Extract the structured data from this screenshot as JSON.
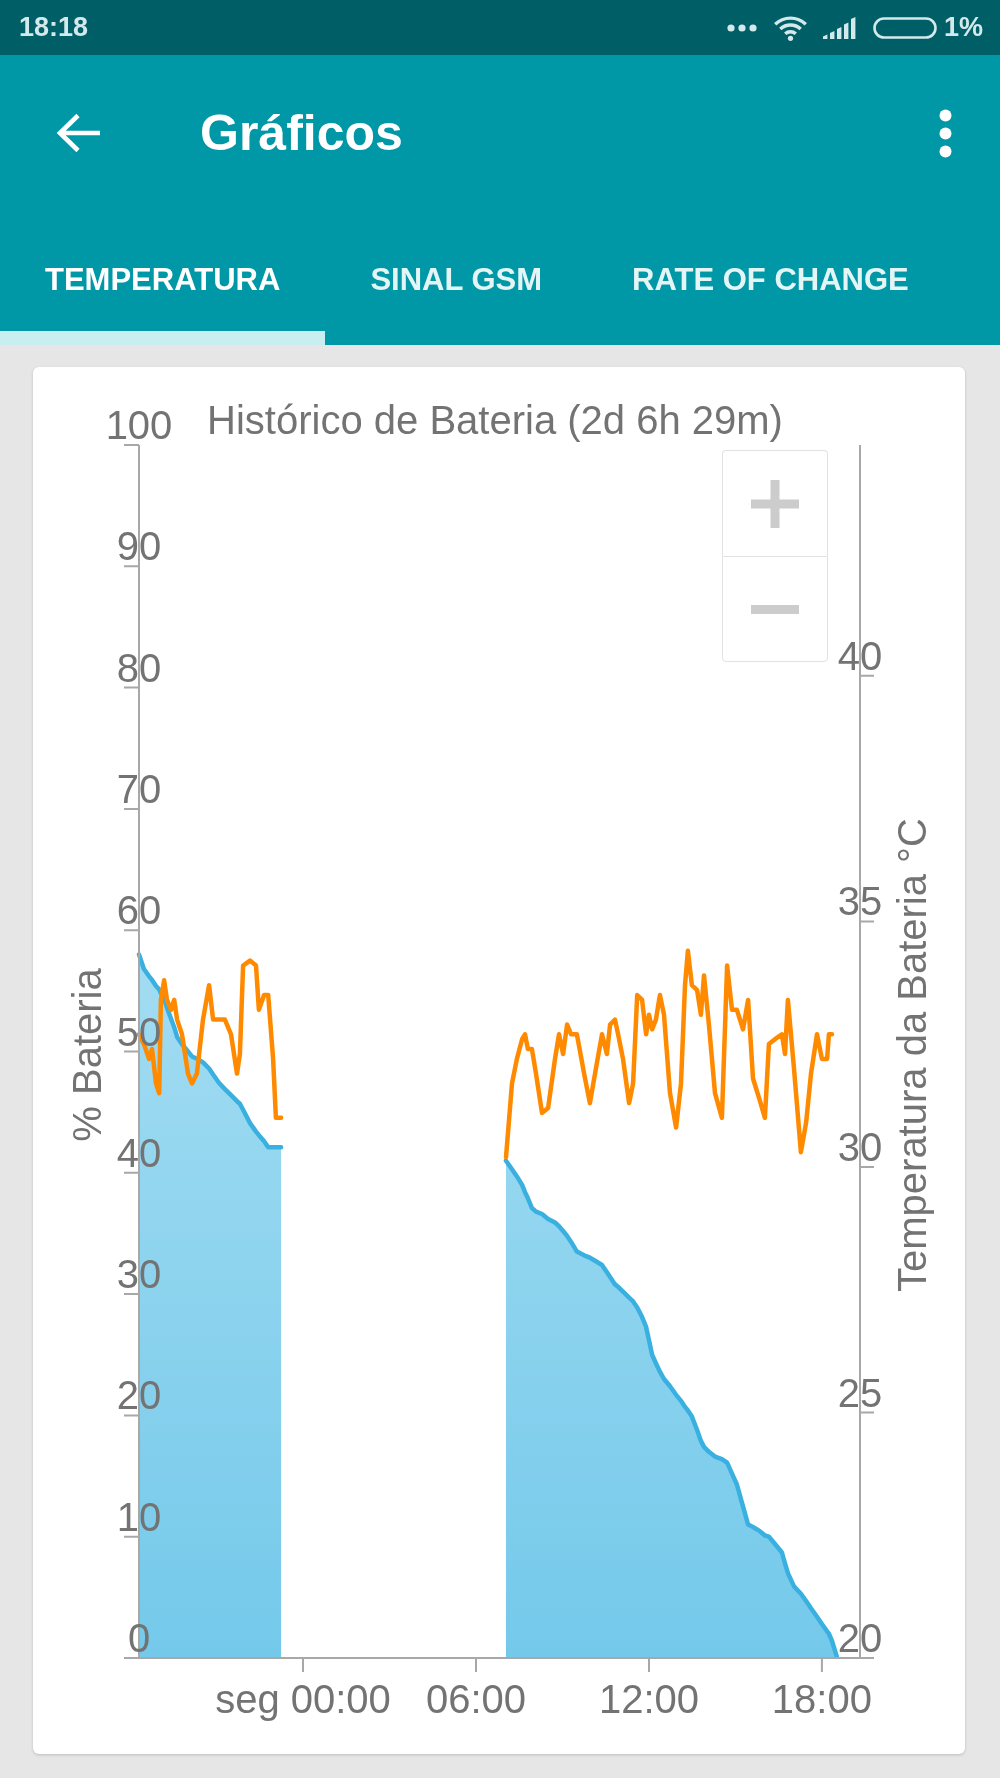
{
  "status_bar": {
    "time": "18:18",
    "battery": "1%"
  },
  "app_bar": {
    "title": "Gráficos"
  },
  "tabs": [
    {
      "label": "TEMPERATURA",
      "selected": true
    },
    {
      "label": "SINAL GSM",
      "selected": false
    },
    {
      "label": "RATE OF CHANGE",
      "selected": false
    }
  ],
  "chart": {
    "chart_data": {
      "type": "area",
      "title": "Histórico de Bateria (2d 6h 29m)",
      "ylabel": "% Bateria",
      "y2label": "Temperatura da Bateria °C",
      "xlim": [
        -5.69,
        19.32
      ],
      "ylim": [
        0,
        100
      ],
      "y2lim": [
        20,
        44.7
      ],
      "xticks": [
        {
          "value": 0,
          "label": "seg 00:00"
        },
        {
          "value": 6,
          "label": "06:00"
        },
        {
          "value": 12,
          "label": "12:00"
        },
        {
          "value": 18,
          "label": "18:00"
        }
      ],
      "yticks": [
        0,
        10,
        20,
        30,
        40,
        50,
        60,
        70,
        80,
        90,
        100
      ],
      "y2ticks": [
        20,
        25,
        30,
        35,
        40
      ],
      "x": [
        -5.69,
        -5.52,
        -5.34,
        -5.24,
        -5.1,
        -4.99,
        -4.93,
        -4.82,
        -4.72,
        -4.58,
        -4.47,
        -4.37,
        -4.2,
        -3.99,
        -3.85,
        -3.68,
        -3.47,
        -3.26,
        -3.12,
        -2.91,
        -2.71,
        -2.5,
        -2.29,
        -2.19,
        -2.08,
        -1.84,
        -1.63,
        -1.53,
        -1.35,
        -1.21,
        -1.04,
        -0.94,
        -0.76,
        3.0,
        7.04,
        7.25,
        7.42,
        7.6,
        7.7,
        7.8,
        7.94,
        8.08,
        8.29,
        8.5,
        8.74,
        8.88,
        9.02,
        9.16,
        9.3,
        9.5,
        9.75,
        9.95,
        10.16,
        10.37,
        10.54,
        10.65,
        10.82,
        10.93,
        11.1,
        11.31,
        11.45,
        11.59,
        11.76,
        11.9,
        12.0,
        12.11,
        12.24,
        12.38,
        12.52,
        12.73,
        12.94,
        13.11,
        13.25,
        13.35,
        13.49,
        13.67,
        13.8,
        13.91,
        14.08,
        14.29,
        14.53,
        14.71,
        14.88,
        15.05,
        15.26,
        15.44,
        15.61,
        15.82,
        16.02,
        16.16,
        16.37,
        16.61,
        16.72,
        16.82,
        17.03,
        17.27,
        17.45,
        17.62,
        17.83,
        18.0,
        18.18,
        18.24,
        18.35,
        18.52
      ],
      "series": [
        {
          "color": "#3ab0e0",
          "values": [
            58.0,
            56.8,
            56.2,
            55.9,
            55.4,
            55.1,
            54.8,
            54.4,
            53.6,
            52.7,
            52.0,
            51.2,
            50.6,
            50.0,
            49.6,
            49.4,
            49.1,
            48.6,
            48.1,
            47.4,
            46.9,
            46.4,
            45.9,
            45.7,
            45.2,
            44.1,
            43.4,
            43.1,
            42.6,
            42.1,
            42.1,
            42.1,
            42.1,
            null,
            41.0,
            40.3,
            39.7,
            39.0,
            38.4,
            37.9,
            37.1,
            36.8,
            36.6,
            36.2,
            35.9,
            35.6,
            35.2,
            34.8,
            34.3,
            33.5,
            33.2,
            33.0,
            32.7,
            32.4,
            31.8,
            31.4,
            30.8,
            30.6,
            30.2,
            29.7,
            29.4,
            28.9,
            28.1,
            27.3,
            26.2,
            25.0,
            24.3,
            23.6,
            23.0,
            22.4,
            21.7,
            21.2,
            20.7,
            20.4,
            19.9,
            18.8,
            17.9,
            17.4,
            17.0,
            16.6,
            16.4,
            16.1,
            15.2,
            14.3,
            12.5,
            11.0,
            10.8,
            10.5,
            10.1,
            10.0,
            9.4,
            8.7,
            7.8,
            7.0,
            5.9,
            5.3,
            4.7,
            4.1,
            3.4,
            2.8,
            2.2,
            2.0,
            1.4,
            0.1
          ]
        },
        {
          "type": "line",
          "axis": "y2",
          "color": "#ff8a00",
          "values": [
            32.7,
            32.5,
            32.2,
            32.4,
            31.7,
            31.5,
            33.4,
            33.8,
            33.4,
            33.2,
            33.4,
            33.0,
            32.7,
            31.9,
            31.7,
            31.9,
            33.0,
            33.7,
            33.0,
            33.0,
            33.0,
            32.7,
            31.9,
            32.3,
            34.1,
            34.2,
            34.1,
            33.2,
            33.5,
            33.5,
            32.2,
            31.0,
            31.0,
            null,
            30.2,
            31.7,
            32.2,
            32.6,
            32.7,
            32.4,
            32.4,
            31.9,
            31.1,
            31.2,
            32.2,
            32.7,
            32.3,
            32.9,
            32.7,
            32.7,
            31.9,
            31.3,
            32.0,
            32.7,
            32.3,
            32.9,
            33.0,
            32.7,
            32.2,
            31.3,
            31.7,
            33.5,
            33.4,
            32.7,
            33.1,
            32.8,
            33.0,
            33.5,
            33.1,
            31.5,
            30.8,
            31.7,
            33.7,
            34.4,
            33.7,
            33.6,
            33.1,
            33.9,
            32.9,
            31.5,
            31.0,
            34.1,
            33.2,
            33.2,
            32.8,
            33.4,
            31.8,
            31.4,
            31.0,
            32.5,
            32.6,
            32.7,
            32.3,
            33.4,
            32.0,
            30.3,
            30.9,
            31.9,
            32.7,
            32.2,
            32.2,
            32.7,
            32.7,
            null
          ]
        }
      ]
    }
  }
}
